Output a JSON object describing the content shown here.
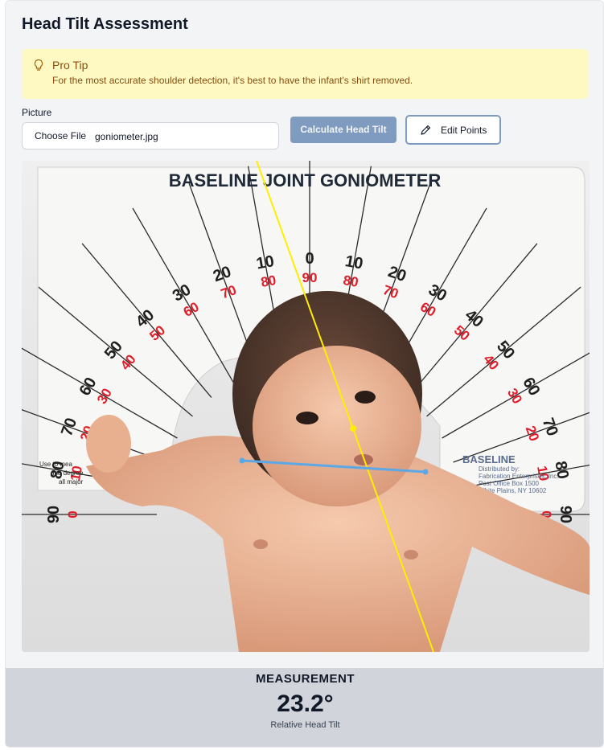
{
  "header": {
    "title": "Head Tilt Assessment"
  },
  "tip": {
    "icon": "lightbulb-icon",
    "title": "Pro Tip",
    "text": "For the most accurate shoulder detection, it's best to have the infant's shirt removed."
  },
  "picture": {
    "label": "Picture",
    "choose_label": "Choose File",
    "file_name": "goniometer.jpg"
  },
  "actions": {
    "calculate_label": "Calculate Head Tilt",
    "edit_label": "Edit Points",
    "edit_icon": "pencil-icon"
  },
  "photo": {
    "goniometer_title": "BASELINE JOINT GONIOMETER",
    "black_scale": [
      "90",
      "80",
      "70",
      "60",
      "50",
      "40",
      "30",
      "20",
      "10",
      "0",
      "10",
      "20",
      "30",
      "40",
      "50",
      "60",
      "70",
      "80",
      "90"
    ],
    "red_scale": [
      "0",
      "10",
      "20",
      "30",
      "40",
      "50",
      "60",
      "70",
      "80",
      "90",
      "80",
      "70",
      "60",
      "50",
      "40",
      "30",
      "20",
      "10",
      "0"
    ],
    "left_note": [
      "Use to mea",
      "and degree",
      "all major"
    ],
    "left_note_tail": [
      "n",
      "t"
    ],
    "brand_block": [
      "BASELINE",
      "Distributed by:",
      "Fabrication Enterprises, Inc.",
      "Post Office Box 1500",
      "White Plains, NY 10602"
    ],
    "midline_color": "#ffee00",
    "shoulder_line_color": "#5aa9e6"
  },
  "measurement": {
    "label": "MEASUREMENT",
    "value": "23.2°",
    "sublabel": "Relative Head Tilt"
  },
  "colors": {
    "accent": "#7f9bbf",
    "tip_bg": "#fef9c3",
    "tip_text": "#854d0e",
    "panel_bg": "#d1d5db"
  }
}
